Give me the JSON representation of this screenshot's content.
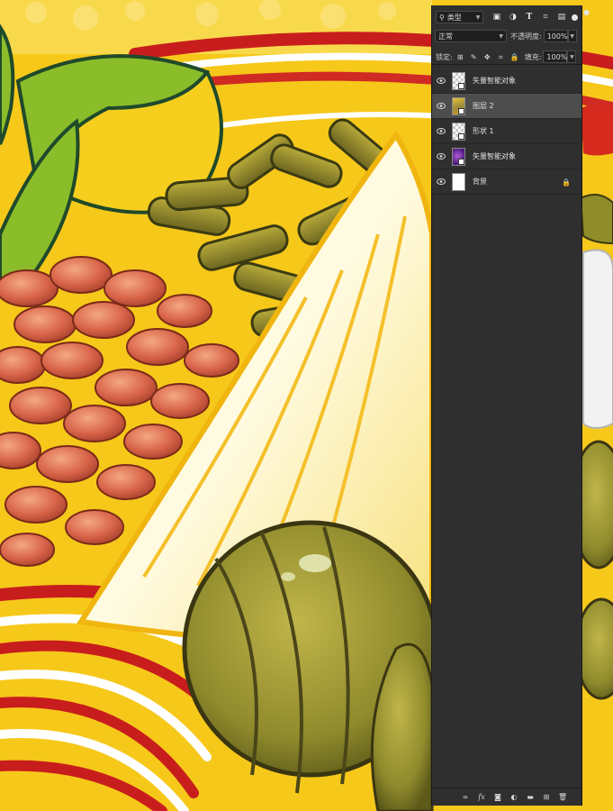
{
  "layers_panel": {
    "filter": {
      "value": "类型"
    },
    "blend_mode": {
      "value": "正常"
    },
    "opacity": {
      "label": "不透明度:",
      "value": "100%"
    },
    "lock": {
      "label": "锁定:"
    },
    "fill": {
      "label": "填充:",
      "value": "100%"
    },
    "layers": [
      {
        "name": "矢量智能对象",
        "thumb": "checker",
        "selected": false
      },
      {
        "name": "图层 2",
        "thumb": "art",
        "selected": true
      },
      {
        "name": "形状 1",
        "thumb": "checker",
        "selected": false
      },
      {
        "name": "矢量智能对象",
        "thumb": "purple",
        "selected": false
      },
      {
        "name": "背景",
        "thumb": "white",
        "selected": false,
        "locked": true
      }
    ],
    "toolbar_icons": [
      "link-icon",
      "fx-icon",
      "mask-icon",
      "adjustment-icon",
      "folder-icon",
      "new-layer-icon",
      "trash-icon"
    ],
    "filter_icons": [
      "image-filter-icon",
      "adjustment-filter-icon",
      "text-filter-icon",
      "shape-filter-icon",
      "smart-object-filter-icon"
    ],
    "lock_icons": [
      "lock-transparent-icon",
      "lock-paint-icon",
      "lock-move-icon",
      "lock-artboard-icon",
      "lock-all-icon"
    ]
  },
  "canvas": {
    "colors": {
      "yellow": "#f6c81a",
      "leaf_green": "#8bbd2a",
      "red_stripe": "#c81d1d",
      "peanut": "#d96a4a",
      "olive": "#8f8c2a",
      "cream": "#fff3b0"
    }
  }
}
